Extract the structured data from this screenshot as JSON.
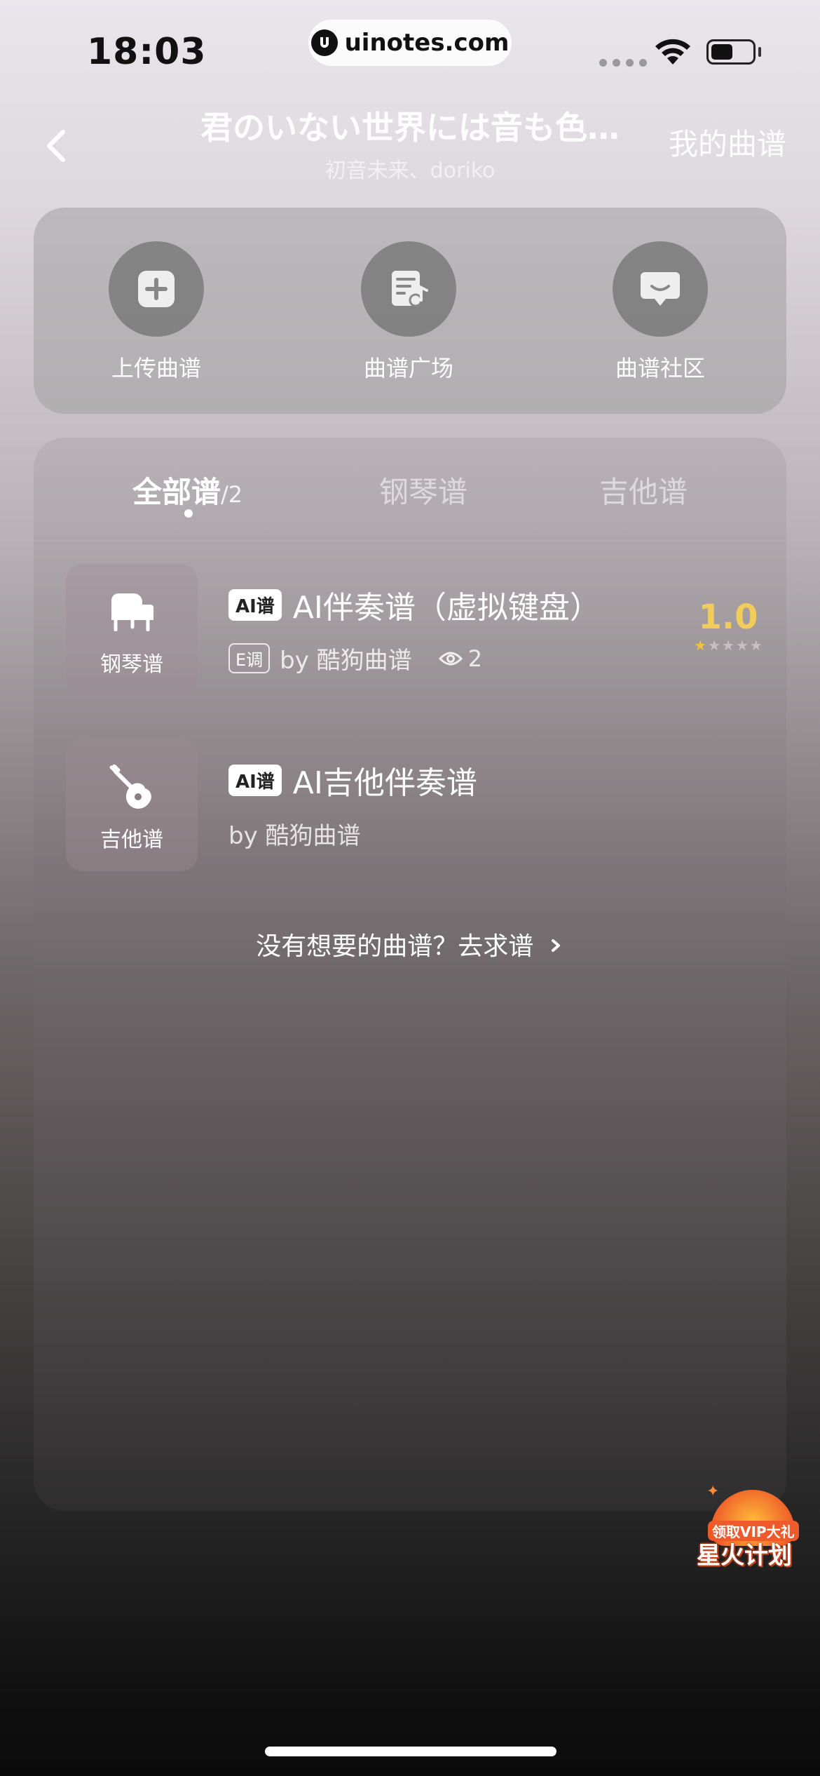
{
  "status_bar": {
    "time": "18:03",
    "url": "uinotes.com"
  },
  "header": {
    "title": "君のいない世界には音も色…",
    "artist": "初音未来、doriko",
    "my_scores": "我的曲谱"
  },
  "quick_actions": [
    {
      "label": "上传曲谱",
      "icon": "plus-icon"
    },
    {
      "label": "曲谱广场",
      "icon": "sheet-music-icon"
    },
    {
      "label": "曲谱社区",
      "icon": "chat-bubble-icon"
    }
  ],
  "tabs": {
    "all_label": "全部谱",
    "all_count": "/2",
    "piano_label": "钢琴谱",
    "guitar_label": "吉他谱"
  },
  "scores": [
    {
      "type_label": "钢琴谱",
      "type_icon": "piano-icon",
      "badge": "AI谱",
      "title": "AI伴奏谱（虚拟键盘）",
      "key": "E调",
      "author": "by 酷狗曲谱",
      "views": "2",
      "rating": "1.0",
      "stars_filled": 1,
      "stars_total": 5
    },
    {
      "type_label": "吉他谱",
      "type_icon": "guitar-icon",
      "badge": "AI谱",
      "title": "AI吉他伴奏谱",
      "author": "by 酷狗曲谱"
    }
  ],
  "request_link": "没有想要的曲谱？去求谱",
  "promo": {
    "top": "领取VIP大礼",
    "main": "星火计划"
  },
  "colors": {
    "rating": "#f2cc5a",
    "star_on": "#f2c23a",
    "promo": "#ef5a2a"
  }
}
